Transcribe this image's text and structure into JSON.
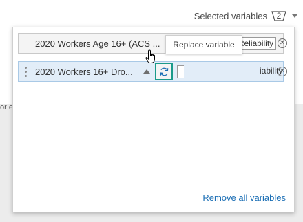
{
  "header": {
    "selected_label": "Selected variables",
    "selected_count": "2"
  },
  "background": {
    "partial_text": "or e"
  },
  "variables": [
    {
      "label": "2020 Workers Age 16+ (ACS ...",
      "format_options": [
        "#",
        "%",
        "Reliability"
      ],
      "active_format": "#"
    },
    {
      "label": "2020 Workers 16+ Dro...",
      "reliability_partial": "iability"
    }
  ],
  "tooltip": {
    "text": "Replace variable"
  },
  "footer": {
    "remove_all_label": "Remove all variables"
  },
  "colors": {
    "accent": "#0079c1",
    "highlight_row": "#e2edf8",
    "focus_ring": "#1a9a8a",
    "link": "#1c6fb5"
  }
}
